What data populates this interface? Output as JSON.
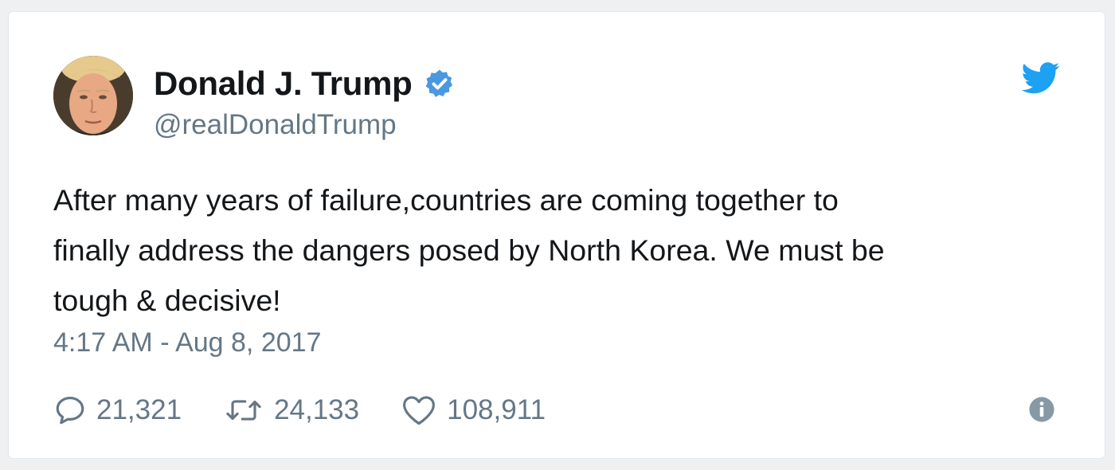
{
  "tweet": {
    "author": {
      "display_name": "Donald J. Trump",
      "handle": "@realDonaldTrump",
      "verified_icon": "verified-badge-icon",
      "avatar_icon": "profile-photo"
    },
    "brand_icon": "twitter-bird-icon",
    "text_lines": [
      "After many years of failure,countries are coming together to",
      "finally address the dangers posed by North Korea. We must be",
      "tough & decisive!"
    ],
    "timestamp": "4:17 AM - Aug 8, 2017",
    "actions": {
      "replies": {
        "icon": "reply-icon",
        "count": "21,321"
      },
      "retweets": {
        "icon": "retweet-icon",
        "count": "24,133"
      },
      "likes": {
        "icon": "heart-icon",
        "count": "108,911"
      },
      "info_icon": "info-icon"
    }
  },
  "colors": {
    "text_primary": "#14171a",
    "text_secondary": "#657786",
    "twitter_blue": "#1da1f2",
    "verified_blue": "#4a98e0",
    "info_gray": "#8899a6"
  }
}
